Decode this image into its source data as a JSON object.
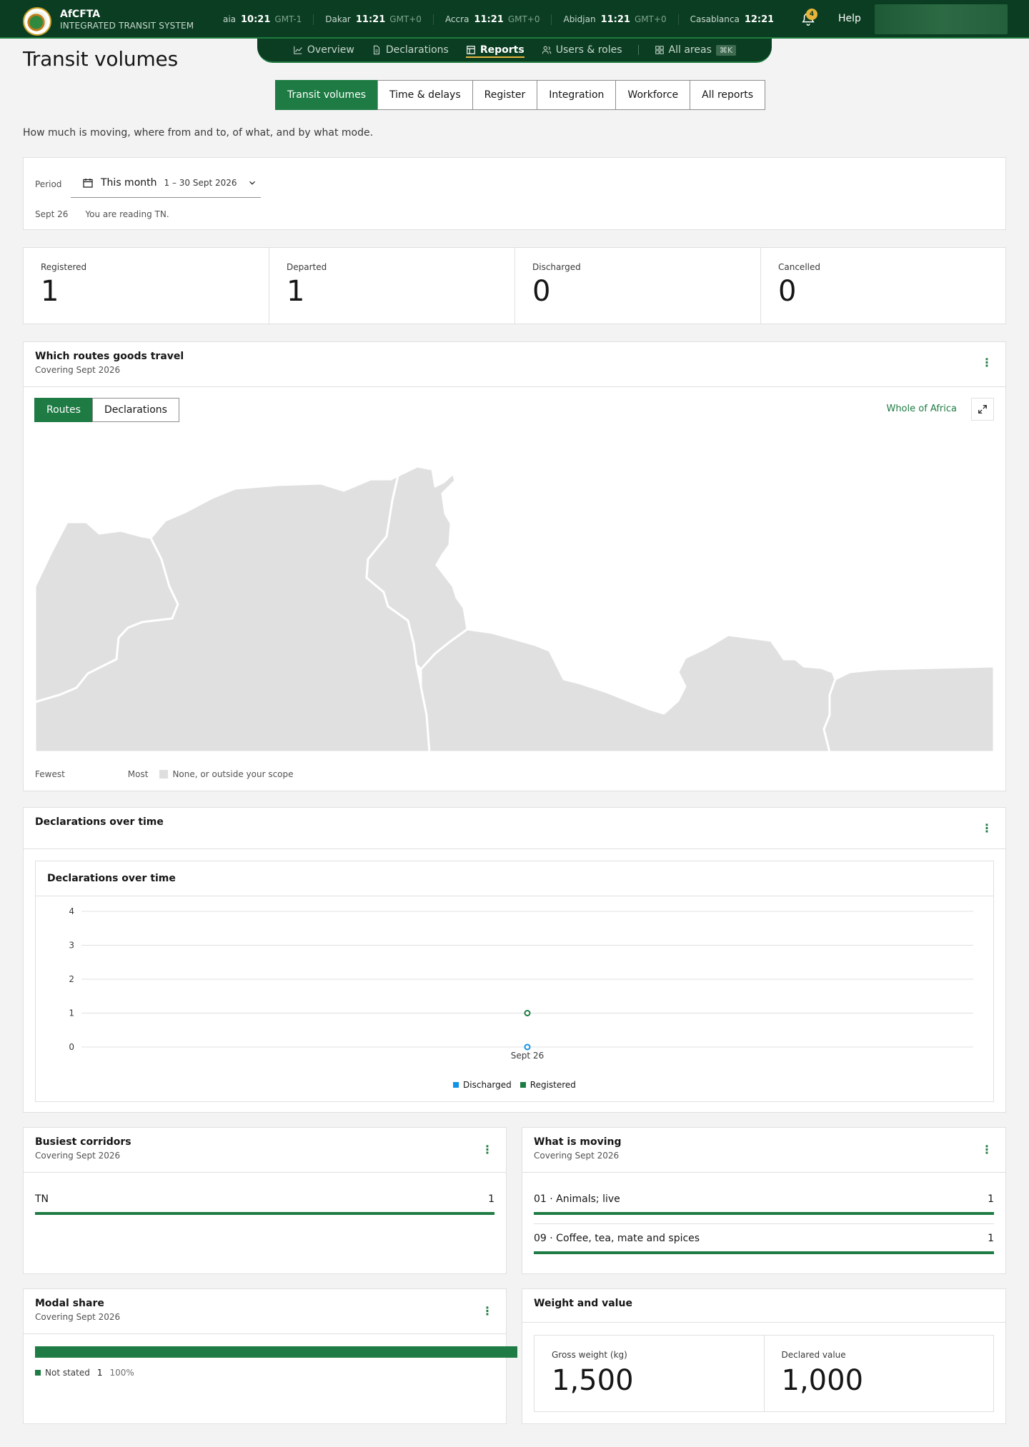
{
  "app": {
    "name": "AfCFTA",
    "subtitle": "INTEGRATED TRANSIT SYSTEM",
    "notifications": "4",
    "help": "Help"
  },
  "clocks": [
    {
      "city": "Praia",
      "time": "10:21",
      "tz": "GMT-1"
    },
    {
      "city": "Dakar",
      "time": "11:21",
      "tz": "GMT+0"
    },
    {
      "city": "Accra",
      "time": "11:21",
      "tz": "GMT+0"
    },
    {
      "city": "Abidjan",
      "time": "11:21",
      "tz": "GMT+0"
    },
    {
      "city": "Casablanca",
      "time": "12:21",
      "tz": ""
    }
  ],
  "nav": {
    "overview": "Overview",
    "declarations": "Declarations",
    "reports": "Reports",
    "users": "Users & roles",
    "all_areas": "All areas",
    "shortcut": "⌘K"
  },
  "page": {
    "title": "Transit volumes",
    "description": "How much is moving, where from and to, of what, and by what mode."
  },
  "report_tabs": [
    "Transit volumes",
    "Time & delays",
    "Register",
    "Integration",
    "Workforce",
    "All reports"
  ],
  "period": {
    "label": "Period",
    "value": "This month",
    "range": "1 – 30 Sept 2026",
    "note_date": "Sept 26",
    "note_text": "You are reading TN."
  },
  "kpis": [
    {
      "label": "Registered",
      "value": "1"
    },
    {
      "label": "Departed",
      "value": "1"
    },
    {
      "label": "Discharged",
      "value": "0"
    },
    {
      "label": "Cancelled",
      "value": "0"
    }
  ],
  "routes_card": {
    "title": "Which routes goods travel",
    "subtitle": "Covering Sept 2026",
    "toggle_routes": "Routes",
    "toggle_declarations": "Declarations",
    "scope": "Whole of Africa",
    "legend_fewest": "Fewest",
    "legend_most": "Most",
    "legend_none": "None, or outside your scope"
  },
  "timeline_card": {
    "title": "Declarations over time",
    "inner_title": "Declarations over time"
  },
  "chart_data": {
    "type": "line",
    "title": "Declarations over time",
    "x": [
      "Sept 26"
    ],
    "series": [
      {
        "name": "Discharged",
        "values": [
          0
        ],
        "color": "#1192e8"
      },
      {
        "name": "Registered",
        "values": [
          1
        ],
        "color": "#1e7b43"
      }
    ],
    "ylim": [
      0,
      4
    ],
    "yticks": [
      0,
      1,
      2,
      3,
      4
    ],
    "grid": true,
    "legend": "bottom-center"
  },
  "corridors": {
    "title": "Busiest corridors",
    "subtitle": "Covering Sept 2026",
    "items": [
      {
        "label": "TN",
        "value": "1",
        "share": 1.0
      }
    ]
  },
  "moving": {
    "title": "What is moving",
    "subtitle": "Covering Sept 2026",
    "items": [
      {
        "label": "01 · Animals; live",
        "value": "1",
        "share": 1.0
      },
      {
        "label": "09 · Coffee, tea, mate and spices",
        "value": "1",
        "share": 1.0
      }
    ]
  },
  "modal": {
    "title": "Modal share",
    "subtitle": "Covering Sept 2026",
    "legend_label": "Not stated",
    "legend_count": "1",
    "legend_pct": "100%",
    "share": 1.0
  },
  "weight_value": {
    "title": "Weight and value",
    "weight_label": "Gross weight (kg)",
    "weight_value": "1,500",
    "value_label": "Declared value",
    "value_value": "1,000"
  },
  "colors": {
    "primary": "#1e7b43",
    "header": "#0b3d22",
    "accent": "#e8b53a",
    "discharged": "#1192e8"
  }
}
